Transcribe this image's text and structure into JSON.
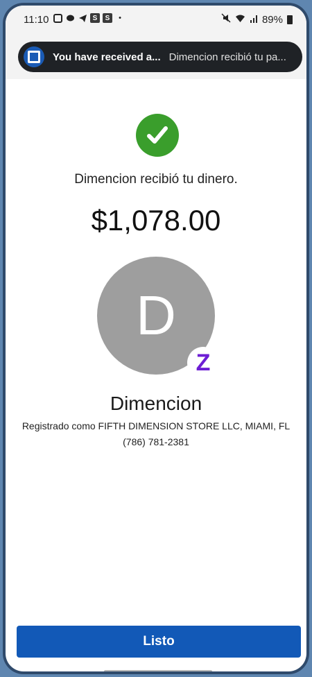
{
  "status_bar": {
    "time": "11:10",
    "left_icons": [
      "chase-app-icon",
      "chat-icon",
      "telegram-icon",
      "s-app-icon",
      "s-app-icon",
      "dot"
    ],
    "right_icons": [
      "mute-icon",
      "wifi-icon",
      "signal-icon"
    ],
    "battery": "89%"
  },
  "notification": {
    "title": "You have received a...",
    "text": "Dimencion recibió tu pa...",
    "app_icon": "chase-logo-icon",
    "colors": {
      "background": "#1f2226",
      "logo": "#1a5bb5"
    }
  },
  "main": {
    "status_icon": "checkmark-icon",
    "headline": "Dimencion recibió tu dinero.",
    "amount": "$1,078.00",
    "avatar_initial": "D",
    "badge_icon": "zelle-icon",
    "badge_letter": "Z",
    "recipient_name": "Dimencion",
    "registered_as": "Registrado como FIFTH DIMENSION STORE LLC, MIAMI, FL",
    "phone": "(786) 781-2381",
    "colors": {
      "success": "#3a9e2c",
      "avatar": "#9e9e9e",
      "zelle": "#6d1ed4"
    }
  },
  "footer": {
    "done_label": "Listo",
    "colors": {
      "button": "#1259b7"
    }
  }
}
